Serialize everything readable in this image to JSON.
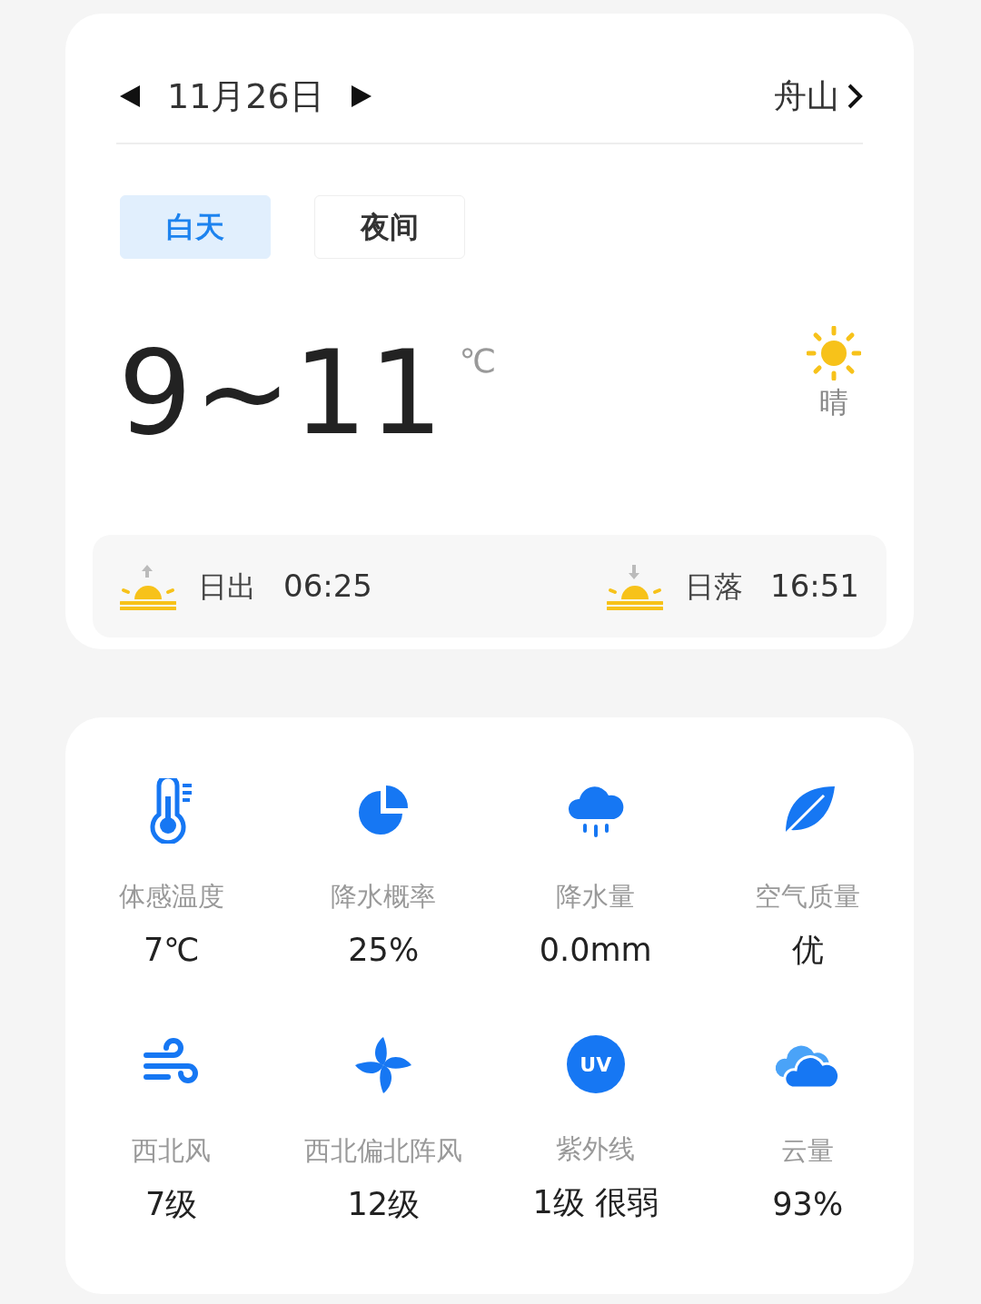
{
  "header": {
    "date": "11月26日",
    "city": "舟山"
  },
  "tabs": [
    {
      "label": "白天",
      "selected": true
    },
    {
      "label": "夜间",
      "selected": false
    }
  ],
  "temperature": {
    "range": "9~11",
    "unit": "℃",
    "condition": "晴"
  },
  "sun": [
    {
      "kind": "sunrise",
      "label": "日出",
      "time": "06:25"
    },
    {
      "kind": "sunset",
      "label": "日落",
      "time": "16:51"
    }
  ],
  "details": [
    {
      "kind": "thermometer",
      "label": "体感温度",
      "value": "7℃"
    },
    {
      "kind": "pie",
      "label": "降水概率",
      "value": "25%"
    },
    {
      "kind": "rain",
      "label": "降水量",
      "value": "0.0mm"
    },
    {
      "kind": "leaf",
      "label": "空气质量",
      "value": "优"
    },
    {
      "kind": "wind",
      "label": "西北风",
      "value": "7级"
    },
    {
      "kind": "pinwheel",
      "label": "西北偏北阵风",
      "value": "12级"
    },
    {
      "kind": "uv",
      "label": "紫外线",
      "value": "1级 很弱",
      "badge": "UV"
    },
    {
      "kind": "cloud",
      "label": "云量",
      "value": "93%"
    }
  ]
}
